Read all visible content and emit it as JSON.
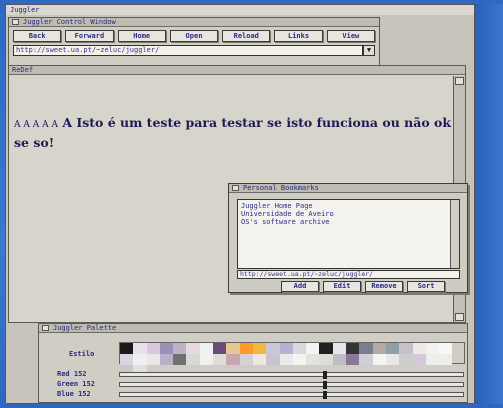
{
  "app": {
    "title": "Juggler"
  },
  "control_window": {
    "title": "Juggler Control Window",
    "buttons": [
      "Back",
      "Forward",
      "Home",
      "Open",
      "Reload",
      "Links",
      "View"
    ],
    "url": "http://sweet.ua.pt/~zeluc/juggler/"
  },
  "page_window": {
    "title": "ReDef",
    "text_prefix": "A A A A A",
    "text_main": "A Isto é um teste para testar se isto funciona ou não ok se so!"
  },
  "bookmarks_window": {
    "title": "Personal Bookmarks",
    "items": [
      "Juggler Home Page",
      "Universidade de Aveiro",
      "OS's software archive"
    ],
    "url": "http://sweet.ua.pt/~zeluc/juggler/",
    "buttons": [
      "Add",
      "Edit",
      "Remove",
      "Sort"
    ]
  },
  "palette_window": {
    "title": "Juggler Palette",
    "swatch_label": "Estilo",
    "sliders": [
      {
        "label": "Red",
        "value": "152",
        "fraction": 0.6
      },
      {
        "label": "Green",
        "value": "152",
        "fraction": 0.6
      },
      {
        "label": "Blue",
        "value": "152",
        "fraction": 0.6
      }
    ],
    "swatches": [
      "#1a1a1a",
      "#e8e0e8",
      "#d8c8dc",
      "#9c90b8",
      "#bcb4c4",
      "#e8d8e0",
      "#f0f0f0",
      "#6a4a7a",
      "#e8c890",
      "#ff9a2a",
      "#f0b840",
      "#c8c8d8",
      "#b8b0d0",
      "#d8d8e0",
      "#f4f4f4",
      "#202020",
      "#e8e4ec",
      "#343434",
      "#78808c",
      "#b8a8a0",
      "#90a0a8",
      "#c8c0c8",
      "#eceae4",
      "#f4f2ee",
      "#f8f8f8",
      "#d8d4e0",
      "#f0eef0",
      "#e8e6e8",
      "#b8b0c8",
      "#707070",
      "#d8d8d8",
      "#f2f0ec",
      "#e0dcd8",
      "#c8a8b0",
      "#d8d0d8",
      "#f0e8e0",
      "#c8c4d0",
      "#eaeaea",
      "#f6f4f0",
      "#e4e2dc",
      "#dedcd6",
      "#c0bcc8",
      "#8a7898",
      "#d0d0d8",
      "#f4f4f4",
      "#e8e8e8",
      "#cccccc",
      "#d6c8dc",
      "#eee",
      "#f0ece8",
      "#c8c8c8",
      "#e0e0e0"
    ]
  }
}
